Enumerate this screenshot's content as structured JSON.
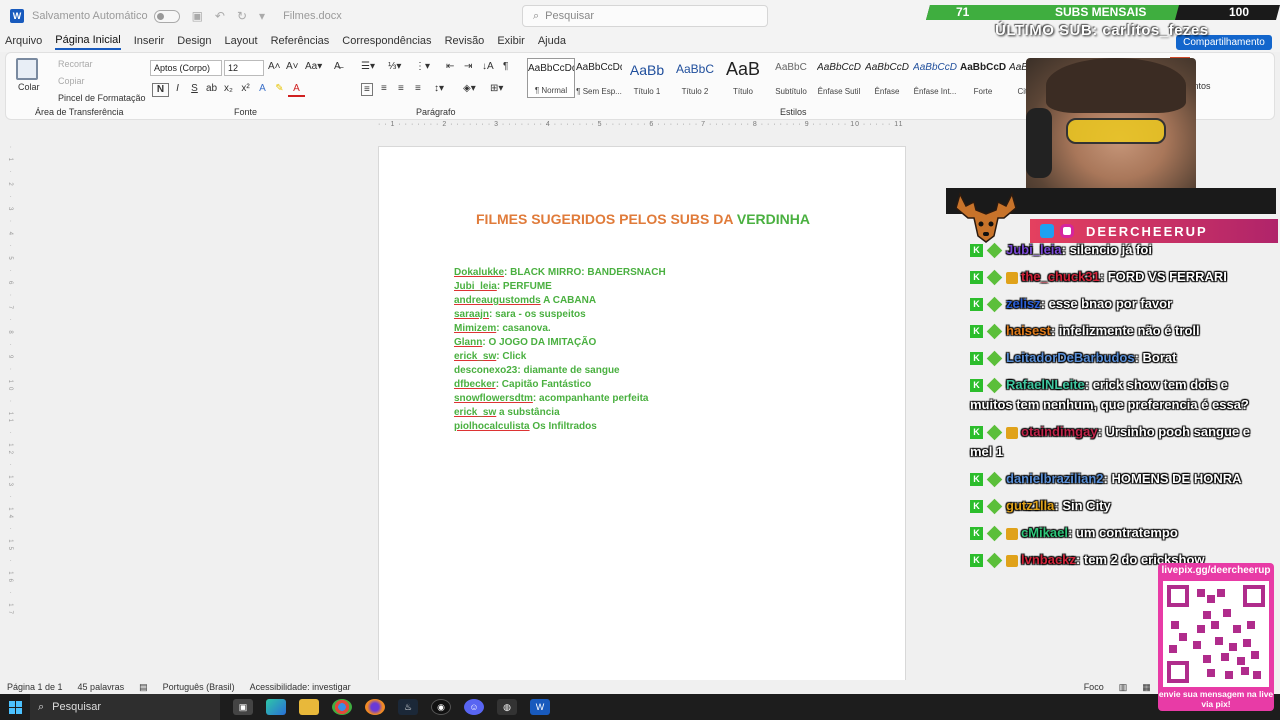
{
  "titlebar": {
    "autosave": "Salvamento Automático",
    "docname": "Filmes.docx",
    "search_placeholder": "Pesquisar"
  },
  "menu": {
    "tabs": [
      "Arquivo",
      "Página Inicial",
      "Inserir",
      "Design",
      "Layout",
      "Referências",
      "Correspondências",
      "Revisão",
      "Exibir",
      "Ajuda"
    ],
    "share": "Compartilhamento"
  },
  "ribbon": {
    "clipboard": {
      "paste": "Colar",
      "cut": "Recortar",
      "copy": "Copiar",
      "format_painter": "Pincel de Formatação",
      "label": "Área de Transferência"
    },
    "font": {
      "family": "Aptos (Corpo)",
      "size": "12",
      "label": "Fonte"
    },
    "paragraph": {
      "label": "Parágrafo"
    },
    "styles": {
      "label": "Estilos",
      "items": [
        {
          "preview": "AaBbCcDd",
          "name": "¶ Normal"
        },
        {
          "preview": "AaBbCcDd",
          "name": "¶ Sem Esp..."
        },
        {
          "preview": "AaBb",
          "name": "Título 1"
        },
        {
          "preview": "AaBbC",
          "name": "Título 2"
        },
        {
          "preview": "AaB",
          "name": "Título"
        },
        {
          "preview": "AaBbC",
          "name": "Subtítulo"
        },
        {
          "preview": "AaBbCcD",
          "name": "Ênfase Sutil"
        },
        {
          "preview": "AaBbCcD",
          "name": "Ênfase"
        },
        {
          "preview": "AaBbCcD",
          "name": "Ênfase Int..."
        },
        {
          "preview": "AaBbCcD",
          "name": "Forte"
        },
        {
          "preview": "AaBbCcD",
          "name": "Citação"
        }
      ]
    },
    "supplements": {
      "label": "Suplementos"
    }
  },
  "document": {
    "title_part1": "FILMES SUGERIDOS PELOS SUBS DA",
    "title_part2": "VERDINHA",
    "entries": [
      {
        "user": "Dokalukke",
        "text": ": BLACK MIRRO: BANDERSNACH"
      },
      {
        "user": "Jubi_leia",
        "text": ": PERFUME"
      },
      {
        "user": "andreaugustomds",
        "text": " A CABANA"
      },
      {
        "user": "saraajn",
        "text": ": sara - os suspeitos"
      },
      {
        "user": "Mimizem",
        "text": ": casanova."
      },
      {
        "user": "Glann",
        "text": ": O JOGO DA IMITAÇÃO"
      },
      {
        "user": "erick_sw",
        "text": ": Click"
      },
      {
        "user": "",
        "text": "desconexo23: diamante de sangue"
      },
      {
        "user": "dfbecker",
        "text": ": Capitão Fantástico"
      },
      {
        "user": "snowflowersdtm",
        "text": ": acompanhante perfeita"
      },
      {
        "user": "erick_sw",
        "text": " a substância"
      },
      {
        "user": "piolhocalculista",
        "text": " Os Infiltrados"
      }
    ]
  },
  "statusbar": {
    "page": "Página 1 de 1",
    "words": "45 palavras",
    "language": "Português (Brasil)",
    "accessibility": "Acessibilidade: investigar",
    "focus": "Foco"
  },
  "taskbar": {
    "search": "Pesquisar"
  },
  "stream": {
    "subs_current": "71",
    "subs_label": "SUBS MENSAIS",
    "subs_goal": "100",
    "subs_progress": 0.71,
    "last_sub": "ÚLTIMO SUB: carlitos_fezes",
    "channel": "DEERCHEERUP",
    "chat": [
      {
        "user": "Jubi_leia",
        "color": "#7a4ad6",
        "msg": ": silencio já foi",
        "extra": false
      },
      {
        "user": "the_chuck31",
        "color": "#d0243a",
        "msg": ": FORD VS FERRARI",
        "extra": true
      },
      {
        "user": "zelisz",
        "color": "#2b5fd6",
        "msg": ": esse bnao por favor",
        "extra": false
      },
      {
        "user": "haisest",
        "color": "#e07b1a",
        "msg": ": infelizmente não é troll",
        "extra": false
      },
      {
        "user": "LeitadorDeBarbudos",
        "color": "#5a8fd6",
        "msg": ": Borat",
        "extra": false
      },
      {
        "user": "RafaelNLeite",
        "color": "#3fc7a0",
        "msg": ": erick show tem dois e muitos tem nenhum, que preferencia é essa?",
        "extra": false
      },
      {
        "user": "otaindimgay",
        "color": "#c0244a",
        "msg": ": Ursinho pooh sangue e mel 1",
        "extra": true
      },
      {
        "user": "danielbrazilian2",
        "color": "#5a8fd6",
        "msg": ": HOMENS DE HONRA",
        "extra": false
      },
      {
        "user": "gutz1lla",
        "color": "#e0a21a",
        "msg": ": Sin City",
        "extra": false
      },
      {
        "user": "cMikael",
        "color": "#2ec77a",
        "msg": ": um contratempo",
        "extra": true
      },
      {
        "user": "lvnbackz",
        "color": "#d0243a",
        "msg": ": tem 2 do erickshow",
        "extra": true
      }
    ],
    "qr_header": "livepix.gg/deercheerup",
    "qr_footer": "envie sua mensagem na live via pix!"
  }
}
